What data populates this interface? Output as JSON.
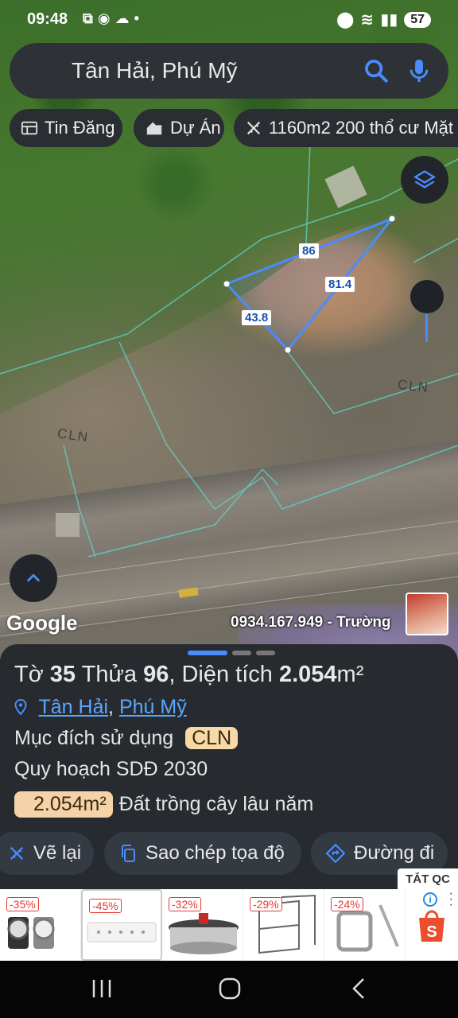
{
  "status_bar": {
    "time": "09:48",
    "battery": "57"
  },
  "search": {
    "query": "Tân Hải, Phú Mỹ"
  },
  "chips": {
    "tin_dang": "Tin Đăng",
    "du_an": "Dự Án",
    "listing": "1160m2 200 thổ cư Mặt"
  },
  "map": {
    "edge_top": "86",
    "edge_right": "81.4",
    "edge_left": "43.8",
    "zone_label_1": "CLN",
    "zone_label_2": "CLN",
    "google_logo": "Google",
    "watermark": "0934.167.949 - Trường"
  },
  "sheet": {
    "title_prefix": "Tờ",
    "sheet_no": "35",
    "parcel_label": "Thửa",
    "parcel_no": "96",
    "area_label": ", Diện tích",
    "area_value": "2.054",
    "area_unit": "m²",
    "loc_ward": "Tân Hải",
    "loc_sep": ",",
    "loc_town": "Phú Mỹ",
    "purpose_label": "Mục đích sử dụng",
    "purpose_code": "CLN",
    "plan_label": "Quy hoạch SDĐ 2030",
    "area_badge": "2.054m²",
    "land_type": "Đất trồng cây lâu năm",
    "actions": {
      "redraw": "Vẽ lại",
      "copy": "Sao chép tọa độ",
      "directions": "Đường đi"
    }
  },
  "ad": {
    "close_label": "TẮT QC",
    "discounts": [
      "-35%",
      "-45%",
      "-32%",
      "-29%",
      "-24%"
    ]
  },
  "colors": {
    "accent_blue": "#4a8cff",
    "sheet_bg": "#272b2f",
    "badge_orange": "#f5d2a7"
  }
}
